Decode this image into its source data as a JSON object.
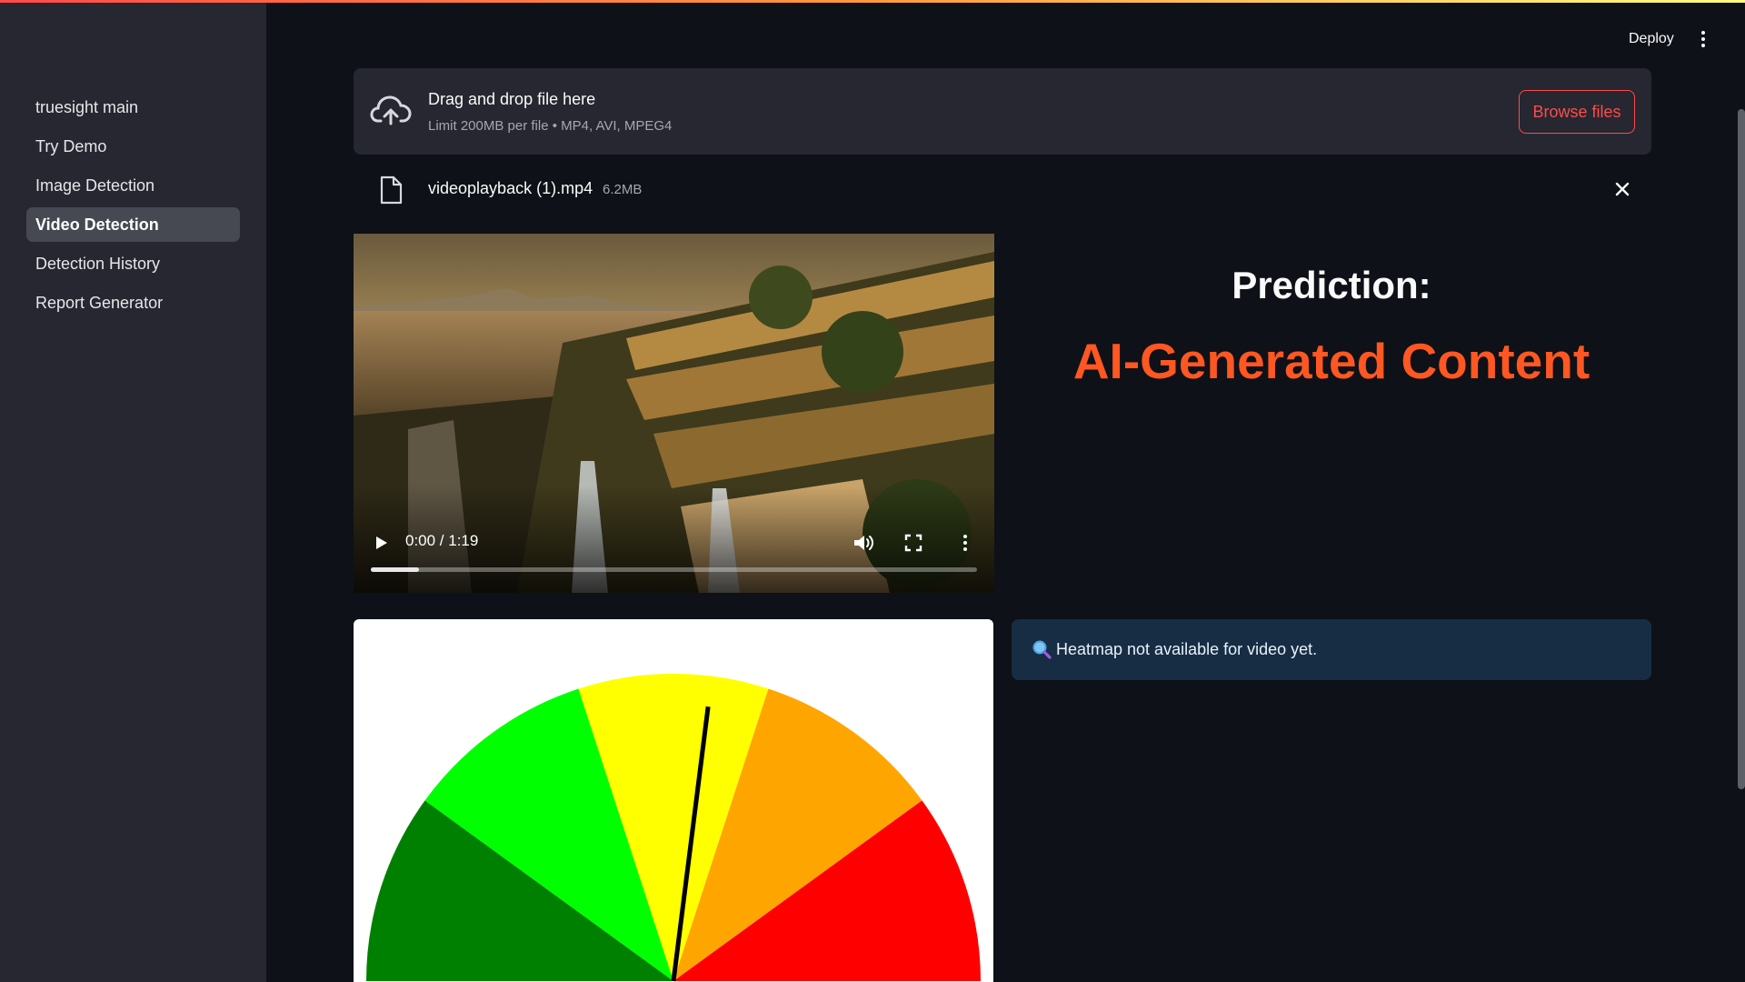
{
  "sidebar": {
    "items": [
      {
        "label": "truesight main"
      },
      {
        "label": "Try Demo"
      },
      {
        "label": "Image Detection"
      },
      {
        "label": "Video Detection",
        "active": true
      },
      {
        "label": "Detection History"
      },
      {
        "label": "Report Generator"
      }
    ]
  },
  "header": {
    "deploy_label": "Deploy",
    "menu_icon": "more-vertical-icon"
  },
  "uploader": {
    "icon": "cloud-upload-icon",
    "title": "Drag and drop file here",
    "limit": "Limit 200MB per file • MP4, AVI, MPEG4",
    "browse_label": "Browse files"
  },
  "file": {
    "icon": "file-icon",
    "name": "videoplayback (1).mp4",
    "size": "6.2MB",
    "remove_icon": "close-icon"
  },
  "video": {
    "time": "0:00 / 1:19",
    "progress_fraction": 0.08
  },
  "prediction": {
    "label": "Prediction:",
    "value": "AI-Generated Content",
    "value_color": "#ff5722"
  },
  "gauge": {
    "segment_colors": [
      "#008000",
      "#00ff00",
      "#ffff00",
      "#ffa500",
      "#ff0000"
    ],
    "needle_fraction": 0.54
  },
  "info": {
    "icon": "magnifier-icon",
    "text": "Heatmap not available for video yet."
  },
  "colors": {
    "accent": "#ff4b4b",
    "background": "#0e1117",
    "sidebar": "#262730",
    "info_bg": "#172d43"
  }
}
